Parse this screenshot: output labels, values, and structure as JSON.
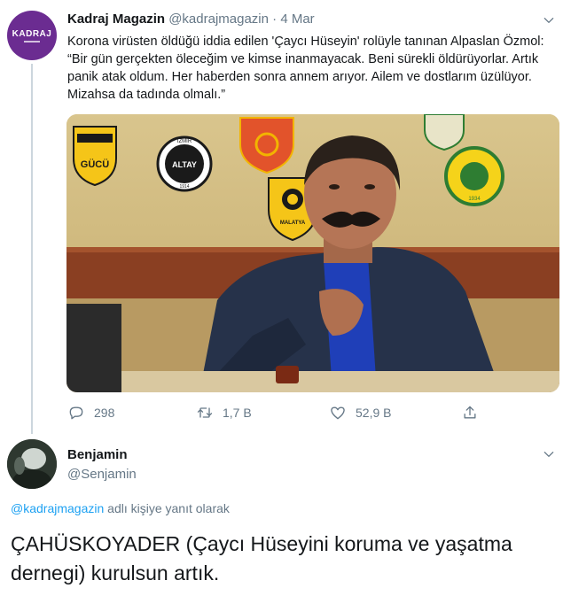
{
  "tweet1": {
    "avatar_text": "KADRAJ",
    "name": "Kadraj Magazin",
    "handle": "@kadrajmagazin",
    "separator": "·",
    "date": "4 Mar",
    "text": "Korona virüsten öldüğü iddia edilen 'Çaycı Hüseyin' rolüyle tanınan Alpaslan Özmol: “Bir gün gerçekten öleceğim ve kimse inanmayacak. Beni sürekli öldürüyorlar. Artık panik atak oldum. Her haberden sonra annem arıyor. Ailem ve dostlarım üzülüyor. Mizahsa da tadında olmalı.”",
    "media": {
      "badge_altay": "ALTAY",
      "badge_izmir": "İZMİR",
      "badge_1914": "1914",
      "badge_gucu": "GÜCÜ",
      "badge_malatya": "MALATYA",
      "badge_1934": "1934"
    },
    "actions": {
      "replies": "298",
      "retweets": "1,7 B",
      "likes": "52,9 B"
    }
  },
  "tweet2": {
    "name": "Benjamin",
    "handle": "@Senjamin",
    "replying_mention": "@kadrajmagazin",
    "replying_suffix": " adlı kişiye yanıt olarak",
    "text": "ÇAHÜSKOYADER (Çaycı Hüseyini koruma ve yaşatma dernegi) kurulsun artık."
  },
  "colors": {
    "accent": "#1da1f2",
    "muted": "#657786",
    "avatar_bg": "#6b2c91",
    "thread_line": "#ccd6dd"
  },
  "icons": [
    "chevron-down-icon",
    "reply-icon",
    "retweet-icon",
    "like-icon",
    "share-icon"
  ]
}
